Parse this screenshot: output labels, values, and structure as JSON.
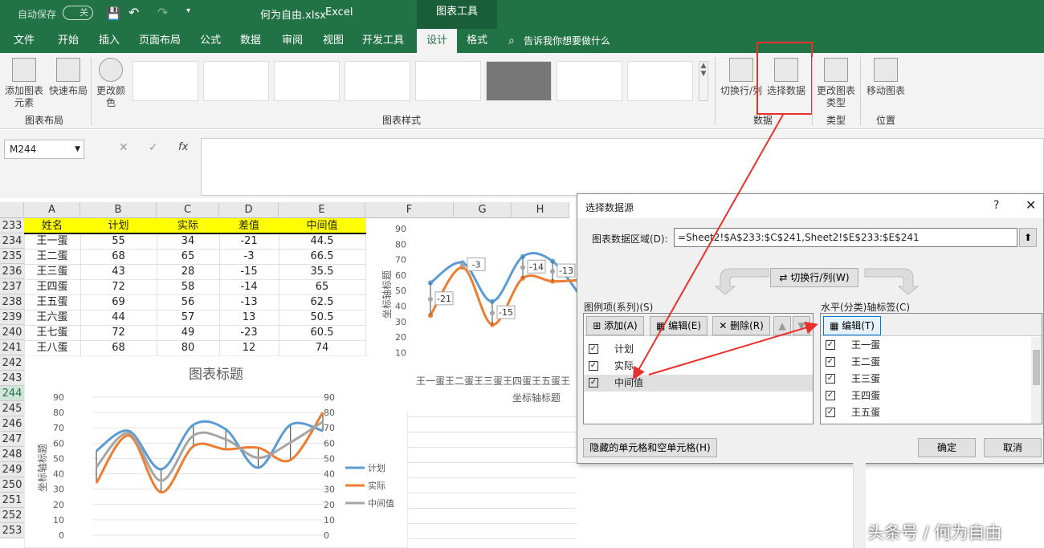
{
  "titlebar": {
    "autosave": "自动保存",
    "autosave_state": "关",
    "filename": "何为自由.xlsx",
    "app": "Excel",
    "context_tool": "图表工具"
  },
  "tabs": [
    "文件",
    "开始",
    "插入",
    "页面布局",
    "公式",
    "数据",
    "审阅",
    "视图",
    "开发工具",
    "设计",
    "格式"
  ],
  "tellme": "告诉我你想要做什么",
  "ribbon": {
    "add_element": "添加图表元素",
    "quick_layout": "快速布局",
    "change_color": "更改颜色",
    "layout_group": "图表布局",
    "styles_group": "图表样式",
    "switch_rowcol": "切换行/列",
    "select_data": "选择数据",
    "data_group": "数据",
    "change_type": "更改图表类型",
    "type_group": "类型",
    "move_chart": "移动图表",
    "location_group": "位置"
  },
  "namebox": "M244",
  "fx": "fx",
  "columns": [
    "A",
    "B",
    "C",
    "D",
    "E",
    "F",
    "G",
    "H"
  ],
  "rows": [
    "233",
    "234",
    "235",
    "236",
    "237",
    "238",
    "239",
    "240",
    "241",
    "242",
    "243",
    "244",
    "245",
    "246",
    "247",
    "248",
    "249",
    "250",
    "251",
    "252",
    "253"
  ],
  "table": {
    "headers": [
      "姓名",
      "计划",
      "实际",
      "差值",
      "中间值"
    ],
    "data": [
      [
        "王一蛋",
        "55",
        "34",
        "-21",
        "44.5"
      ],
      [
        "王二蛋",
        "68",
        "65",
        "-3",
        "66.5"
      ],
      [
        "王三蛋",
        "43",
        "28",
        "-15",
        "35.5"
      ],
      [
        "王四蛋",
        "72",
        "58",
        "-14",
        "65"
      ],
      [
        "王五蛋",
        "69",
        "56",
        "-13",
        "62.5"
      ],
      [
        "王六蛋",
        "44",
        "57",
        "13",
        "50.5"
      ],
      [
        "王七蛋",
        "72",
        "49",
        "-23",
        "60.5"
      ],
      [
        "王八蛋",
        "68",
        "80",
        "12",
        "74"
      ]
    ]
  },
  "chart_data": [
    {
      "type": "line",
      "title": "图表标题",
      "ylabel": "坐标轴标题",
      "ylim": [
        0,
        90
      ],
      "yticks": [
        "90",
        "80",
        "70",
        "60",
        "50",
        "40",
        "30",
        "20",
        "10",
        "0"
      ],
      "categories": [
        "王一蛋",
        "王二蛋",
        "王三蛋",
        "王四蛋",
        "王五蛋",
        "王六蛋",
        "王七蛋",
        "王八蛋"
      ],
      "series": [
        {
          "name": "计划",
          "values": [
            55,
            68,
            43,
            72,
            69,
            44,
            72,
            68
          ],
          "color": "#5b9bd5"
        },
        {
          "name": "实际",
          "values": [
            34,
            65,
            28,
            58,
            56,
            57,
            49,
            80
          ],
          "color": "#ed7d31"
        },
        {
          "name": "中间值",
          "values": [
            44.5,
            66.5,
            35.5,
            65,
            62.5,
            50.5,
            60.5,
            74
          ],
          "color": "#a5a5a5"
        }
      ],
      "legend": "right"
    },
    {
      "type": "line",
      "xlabel": "坐标轴标题",
      "ylabel": "坐标轴标题",
      "ylim": [
        10,
        90
      ],
      "yticks": [
        "90",
        "80",
        "70",
        "60",
        "50",
        "40",
        "30",
        "20",
        "10"
      ],
      "xticklabels": "王一蛋王二蛋王三蛋王四蛋王五蛋王",
      "data_labels": [
        "-21",
        "-3",
        "-15",
        "-14",
        "-13"
      ]
    }
  ],
  "dialog": {
    "title": "选择数据源",
    "help": "?",
    "range_label": "图表数据区域(D):",
    "range_value": "=Sheet2!$A$233:$C$241,Sheet2!$E$233:$E$241",
    "switch": "切换行/列(W)",
    "legend_label": "图例项(系列)(S)",
    "add": "添加(A)",
    "edit": "编辑(E)",
    "delete": "删除(R)",
    "series": [
      "计划",
      "实际",
      "中间值"
    ],
    "axis_label": "水平(分类)轴标签(C)",
    "axis_edit": "编辑(T)",
    "categories": [
      "王一蛋",
      "王二蛋",
      "王三蛋",
      "王四蛋",
      "王五蛋"
    ],
    "hidden": "隐藏的单元格和空单元格(H)",
    "ok": "确定",
    "cancel": "取消"
  },
  "watermark": "头条号 / 何为自由"
}
